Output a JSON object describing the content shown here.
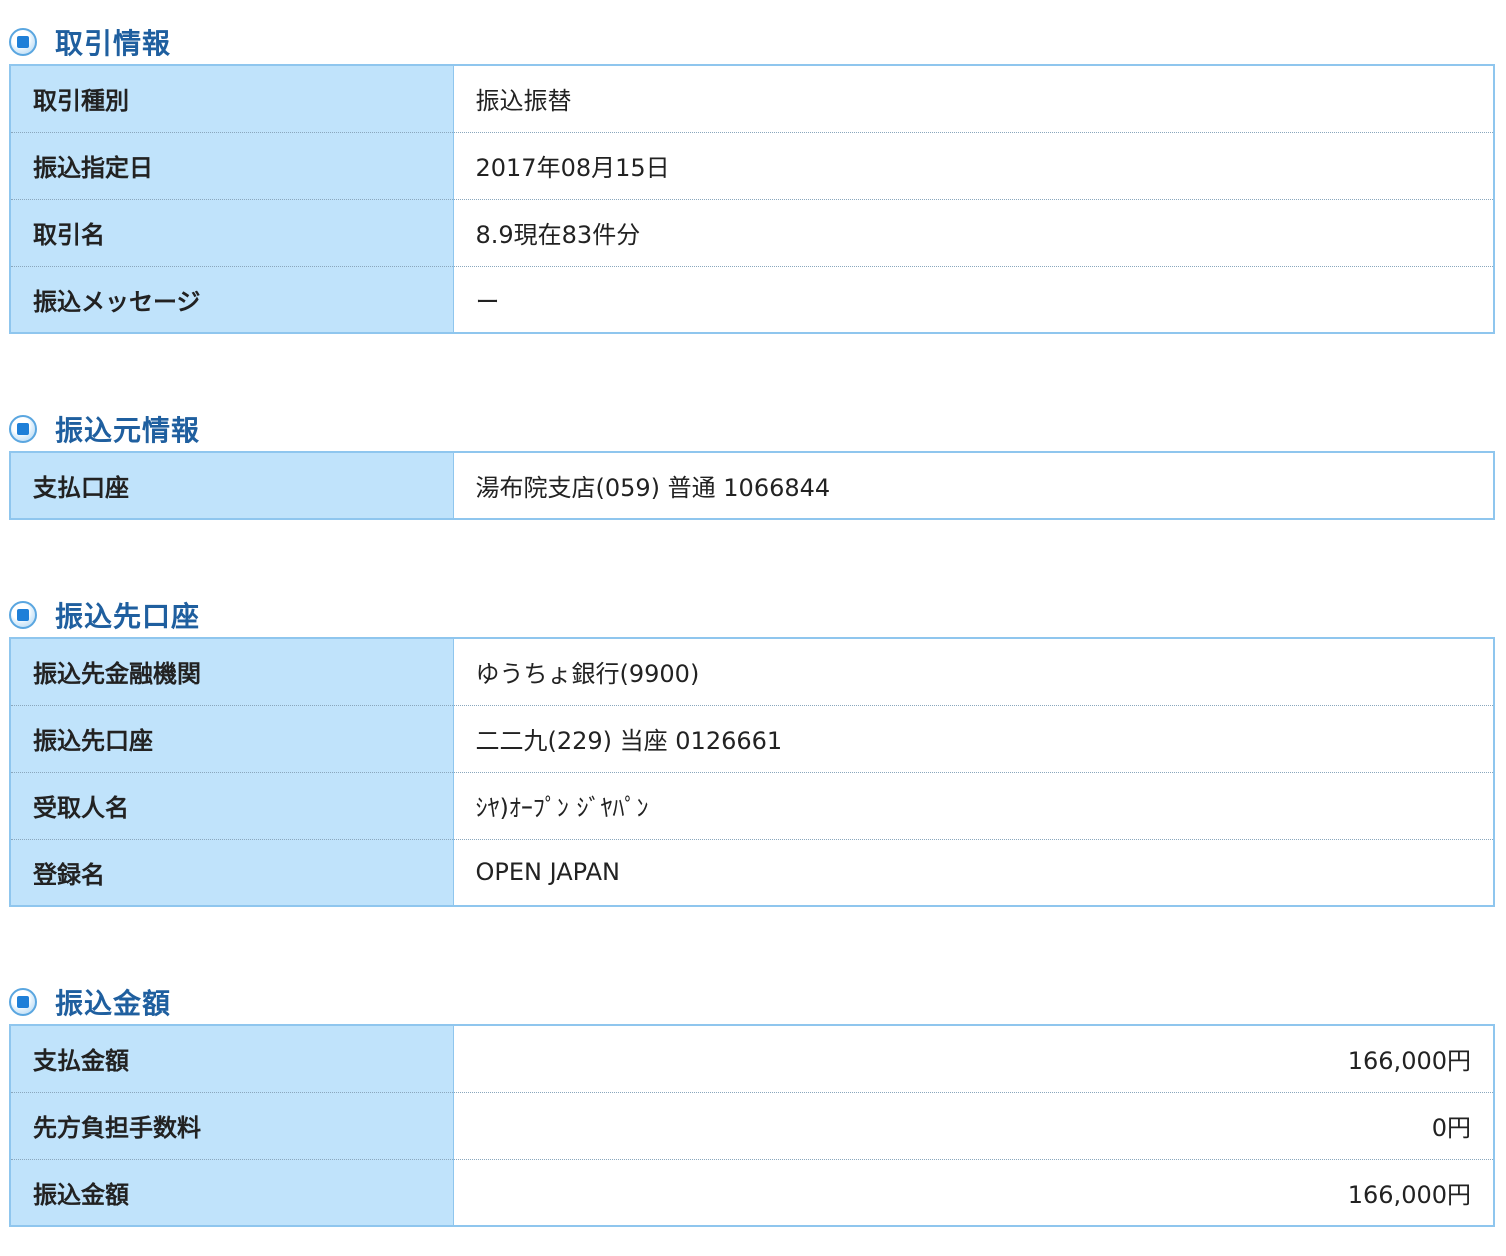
{
  "sections": {
    "transaction": {
      "title": "取引情報",
      "rows": [
        {
          "label": "取引種別",
          "value": "振込振替"
        },
        {
          "label": "振込指定日",
          "value": "2017年08月15日"
        },
        {
          "label": "取引名",
          "value": "8.9現在83件分"
        },
        {
          "label": "振込メッセージ",
          "value": "ー"
        }
      ]
    },
    "source": {
      "title": "振込元情報",
      "rows": [
        {
          "label": "支払口座",
          "value": "湯布院支店(059) 普通 1066844"
        }
      ]
    },
    "destination": {
      "title": "振込先口座",
      "rows": [
        {
          "label": "振込先金融機関",
          "value": "ゆうちょ銀行(9900)"
        },
        {
          "label": "振込先口座",
          "value": "二二九(229) 当座 0126661"
        },
        {
          "label": "受取人名",
          "value": "ｼﾔ)ｵｰﾌﾟﾝ ｼﾞﾔﾊﾟﾝ"
        },
        {
          "label": "登録名",
          "value": "OPEN JAPAN"
        }
      ]
    },
    "amount": {
      "title": "振込金額",
      "rows": [
        {
          "label": "支払金額",
          "value": "166,000円"
        },
        {
          "label": "先方負担手数料",
          "value": "0円"
        },
        {
          "label": "振込金額",
          "value": "166,000円"
        }
      ]
    }
  },
  "colors": {
    "heading": "#1f5f9f",
    "label_bg": "#c0e3fb",
    "border": "#8fc6ee",
    "bullet": "#1e7fd8"
  }
}
